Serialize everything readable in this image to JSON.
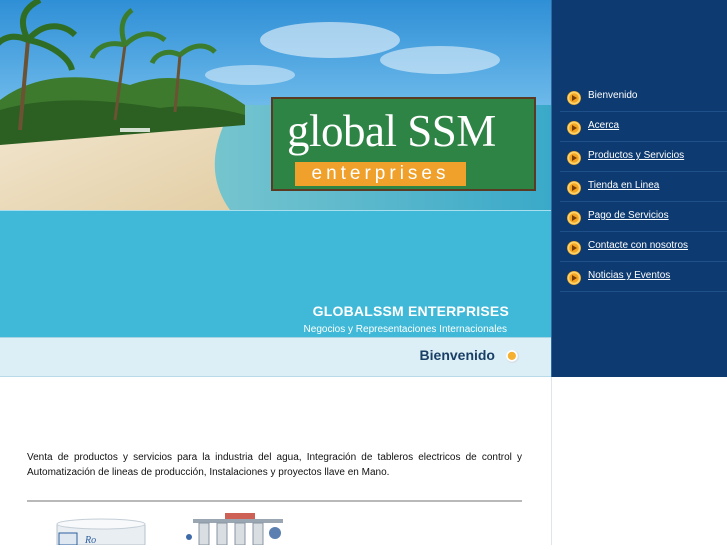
{
  "logo": {
    "main": "global SSM",
    "sub": "enterprises"
  },
  "banner": {
    "company_name": "GLOBALSSM ENTERPRISES",
    "tagline": "Negocios y Representaciones Internacionales"
  },
  "page": {
    "title": "Bienvenido"
  },
  "nav": [
    {
      "label": "Bienvenido",
      "active": true
    },
    {
      "label": "Acerca",
      "active": false
    },
    {
      "label": "Productos y Servicios",
      "active": false
    },
    {
      "label": "Tienda en Linea",
      "active": false
    },
    {
      "label": "Pago de Servicios",
      "active": false
    },
    {
      "label": "Contacte con nosotros",
      "active": false
    },
    {
      "label": "Noticias y Eventos",
      "active": false
    }
  ],
  "intro_text": "Venta de productos y servicios para la industria del agua, Integración de tableros electricos de control y Automatización de lineas de producción, Instalaciones y proyectos llave en Mano.",
  "colors": {
    "sidebar": "#0d3a70",
    "band": "#3fb9d7",
    "logo_green": "#2e8445",
    "logo_orange": "#f0a12b",
    "title_text": "#1a3f66"
  },
  "icons": [
    "arrow-bullet-icon",
    "circle-bullet-icon"
  ]
}
